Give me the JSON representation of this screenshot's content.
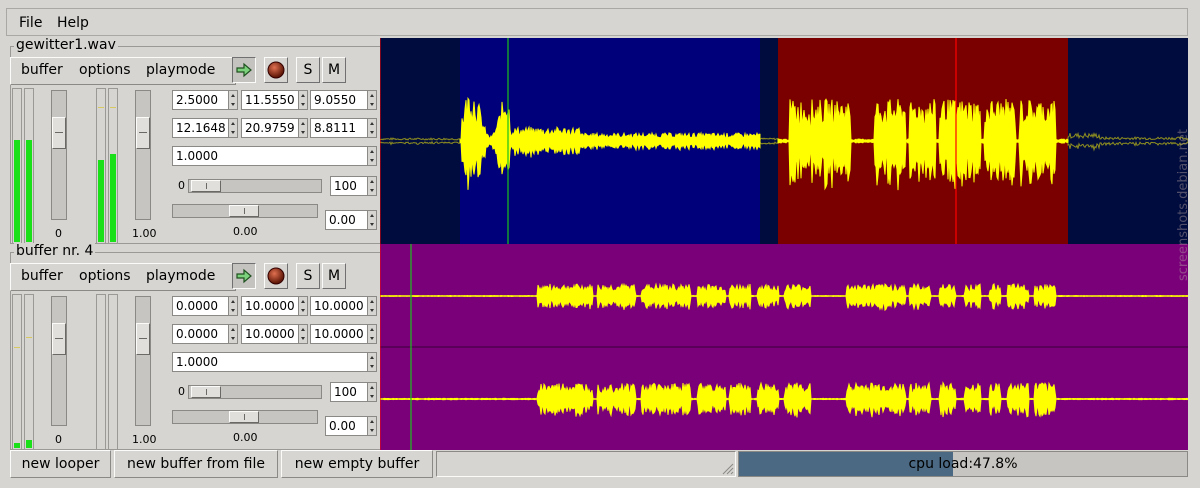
{
  "menubar": {
    "items": [
      "File",
      "Help"
    ]
  },
  "colors": {
    "background": "#d6d5d1",
    "wave_yellow": "#ffff00",
    "wave_dim": "#8f8f20",
    "loop1_bg": "#000c3d",
    "loop1_region_blue": "#00007a",
    "loop1_region_red": "#7a0000",
    "loop2_bg": "#7a007a",
    "meter_green": "#19e019",
    "cursor_green": "#19c019",
    "cursor_red": "#ff0000"
  },
  "loopers": [
    {
      "title": "gewitter1.wav",
      "menu": [
        "buffer",
        "options",
        "playmode"
      ],
      "play_icon": "play-arrow-icon",
      "record_icon": "record-icon",
      "solo_label": "S",
      "mute_label": "M",
      "meters": [
        0.66,
        0.66,
        0.53,
        0.57
      ],
      "volume_label": "0",
      "pan_label": "1.00",
      "row1": [
        "2.5000",
        "11.5550",
        "9.0550"
      ],
      "row2": [
        "12.1648",
        "20.9759",
        "8.8111"
      ],
      "speed": "1.0000",
      "min_label": "0",
      "max_value": "100",
      "slider_value": "0.00",
      "pan_slider_label": "0.00"
    },
    {
      "title": "buffer nr. 4",
      "menu": [
        "buffer",
        "options",
        "playmode"
      ],
      "play_icon": "play-arrow-icon",
      "record_icon": "record-icon",
      "solo_label": "S",
      "mute_label": "M",
      "meters": [
        0.03,
        0.05,
        0.0,
        0.0
      ],
      "volume_label": "0",
      "pan_label": "1.00",
      "row1": [
        "0.0000",
        "10.0000",
        "10.0000"
      ],
      "row2": [
        "0.0000",
        "10.0000",
        "10.0000"
      ],
      "speed": "1.0000",
      "min_label": "0",
      "max_value": "100",
      "slider_value": "0.00",
      "pan_slider_label": "0.00"
    }
  ],
  "bottom": {
    "new_looper": "new looper",
    "new_buffer_from_file": "new buffer from file",
    "new_empty_buffer": "new empty buffer",
    "cpu_load": "cpu load:47.8%",
    "cpu_fraction": 0.478
  },
  "watermark": "screenshots.debian.net"
}
